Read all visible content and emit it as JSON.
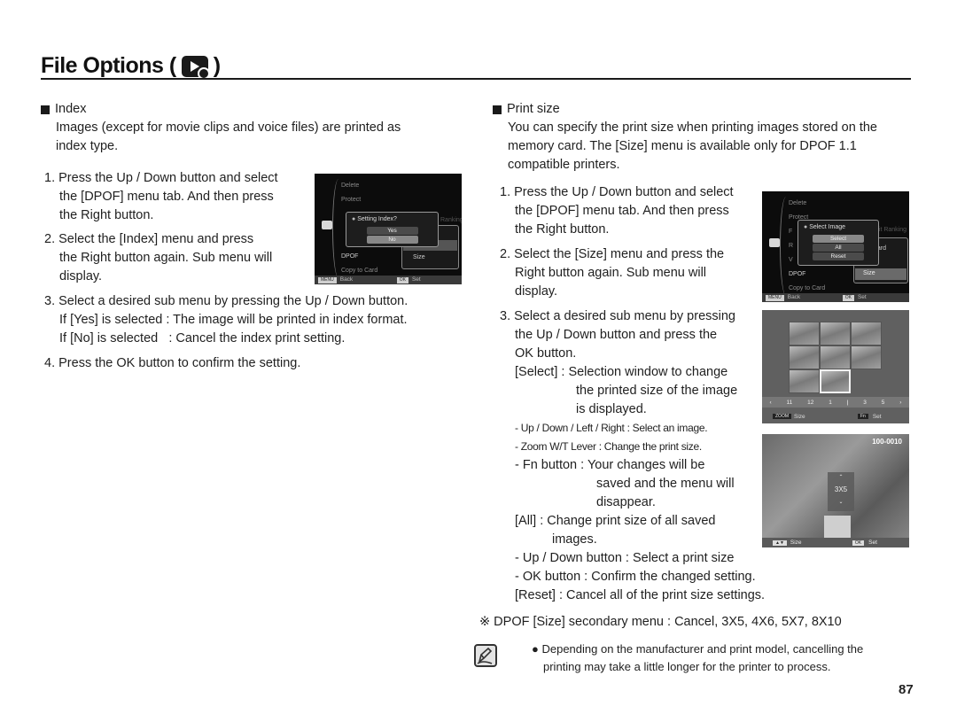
{
  "header": {
    "title": "File Options (",
    "title_close": ")",
    "title_icon": "playback-mode-icon"
  },
  "left": {
    "section_title": "Index",
    "description": "Images (except for movie clips and voice files) are printed as index type.",
    "description_line1": "Images (except for movie clips and voice files) are printed as",
    "description_line2": "index type.",
    "steps": [
      {
        "num": "1.",
        "lines": [
          "Press the Up / Down button and select",
          "the [DPOF] menu tab. And then press",
          "the Right button."
        ]
      },
      {
        "num": "2.",
        "lines": [
          "Select the [Index] menu and press",
          "the Right button again. Sub menu will",
          "display."
        ]
      },
      {
        "num": "3.",
        "lines": [
          "Select a desired sub menu by pressing the Up / Down button."
        ]
      },
      {
        "num": "4.",
        "lines": [
          "Press the OK button to confirm the setting."
        ]
      }
    ],
    "step3_options": [
      {
        "label": "If [Yes] is selected",
        "desc": ": The image will be printed in index format."
      },
      {
        "label": "If [No] is selected",
        "desc": ": Cancel the index print setting."
      }
    ],
    "screen": {
      "menu_items": [
        "Delete",
        "Protect",
        "",
        "",
        "",
        "DPOF",
        "Copy to Card"
      ],
      "right_partial": "Ranking",
      "submenu_partial": "d",
      "submenu_size": "Size",
      "popup_title": "Setting Index?",
      "popup_options": [
        "Yes",
        "No"
      ],
      "popup_selected": "No",
      "footer_key1": "MENU",
      "footer_label1": "Back",
      "footer_key2": "OK",
      "footer_label2": "Set"
    }
  },
  "right": {
    "section_title": "Print size",
    "description_lines": [
      "You can specify the print size when printing images stored on the",
      "memory card. The [Size] menu is available only for DPOF 1.1",
      "compatible printers."
    ],
    "steps": [
      {
        "num": "1.",
        "lines": [
          "Press the Up / Down button and select",
          "the [DPOF] menu tab. And then press",
          "the Right button."
        ]
      },
      {
        "num": "2.",
        "lines": [
          "Select the [Size] menu and press the",
          "Right button again. Sub menu will",
          "display."
        ]
      },
      {
        "num": "3.",
        "lines": [
          "Select a desired sub menu by pressing",
          "the Up / Down button and press the",
          "OK button."
        ]
      }
    ],
    "select_label": "[Select] : Selection window to change",
    "select_cont": [
      "the printed size of the image",
      "is displayed."
    ],
    "select_subitems": [
      "- Up / Down / Left / Right : Select an image.",
      "- Zoom W/T Lever : Change the print size."
    ],
    "fn_item": "- Fn button : Your changes will be",
    "fn_cont": [
      "saved and the menu will",
      "disappear."
    ],
    "all_label": "[All] : Change print size of all saved",
    "all_cont": "images.",
    "all_subitems": [
      "- Up / Down button : Select a print size",
      "- OK button : Confirm the changed setting."
    ],
    "reset_label": "[Reset] : Cancel all of the print size settings.",
    "secondary_menu_note": "※ DPOF [Size] secondary menu : Cancel, 3X5, 4X6, 5X7, 8X10",
    "note_text_lines": [
      "Depending on the manufacturer and print model, cancelling the",
      "printing may take a little longer for the printer to process."
    ],
    "screen1": {
      "menu_items": [
        "Delete",
        "Protect",
        "F",
        "R",
        "V",
        "DPOF",
        "Copy to Card"
      ],
      "right_partial": "dit Ranking",
      "submenu_partial": "dard",
      "submenu_size": "Size",
      "popup_title": "Select Image",
      "popup_options": [
        "Select",
        "All",
        "Reset"
      ],
      "popup_selected": "Select",
      "footer_key1": "MENU",
      "footer_label1": "Back",
      "footer_key2": "OK",
      "footer_label2": "Set"
    },
    "screen2": {
      "timeline": [
        "11",
        "12",
        "1",
        "3",
        "5"
      ],
      "footer_key1": "ZOOM",
      "footer_label1": "Size",
      "footer_key2": "Fn",
      "footer_label2": "Set"
    },
    "screen3": {
      "file_number": "100-0010",
      "print_size": "3X5",
      "footer_key1": "▲▼",
      "footer_label1": "Size",
      "footer_key2": "OK",
      "footer_label2": "Set"
    }
  },
  "page_number": "87"
}
